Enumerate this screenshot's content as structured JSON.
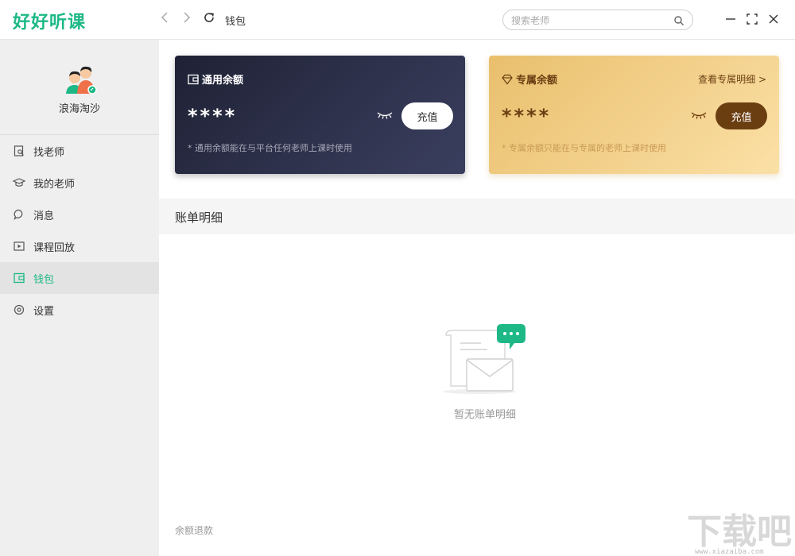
{
  "app": {
    "logo_text": "好好听课"
  },
  "toolbar": {
    "page_title": "钱包"
  },
  "search": {
    "placeholder": "搜索老师",
    "value": ""
  },
  "user": {
    "name": "浪海淘沙"
  },
  "sidebar": {
    "items": [
      {
        "label": "找老师",
        "icon": "find-teacher-icon",
        "active": false
      },
      {
        "label": "我的老师",
        "icon": "graduation-cap-icon",
        "active": false
      },
      {
        "label": "消息",
        "icon": "chat-bubble-icon",
        "active": false
      },
      {
        "label": "课程回放",
        "icon": "play-icon",
        "active": false
      },
      {
        "label": "钱包",
        "icon": "wallet-icon",
        "active": true
      },
      {
        "label": "设置",
        "icon": "settings-icon",
        "active": false
      }
    ]
  },
  "wallet": {
    "general": {
      "title": "通用余额",
      "amount": "****",
      "recharge_label": "充值",
      "note": "* 通用余额能在与平台任何老师上课时使用"
    },
    "exclusive": {
      "title": "专属余额",
      "link_label": "查看专属明细 >",
      "amount": "****",
      "recharge_label": "充值",
      "note": "* 专属余额只能在与专属的老师上课时使用"
    }
  },
  "bill": {
    "title": "账单明细",
    "empty_text": "暂无账单明细"
  },
  "footer": {
    "refund_label": "余额退款"
  },
  "watermark": {
    "text": "下载吧",
    "url_text": "www.xiazaiba.com"
  },
  "colors": {
    "brand_green": "#1db886",
    "dark_card": "#2a2e45",
    "gold_card": "#f1cf88",
    "gold_button": "#6b3e12"
  }
}
